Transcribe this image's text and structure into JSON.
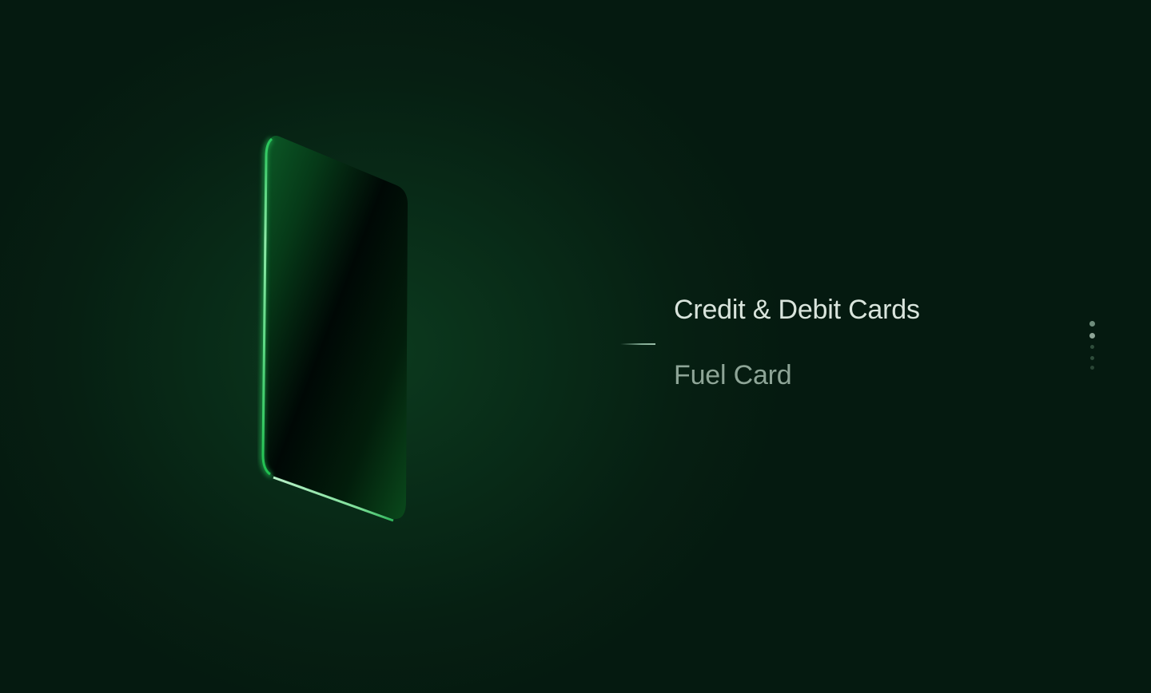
{
  "menu": {
    "items": [
      {
        "label": "Credit & Debit Cards",
        "active": true
      },
      {
        "label": "Fuel Card",
        "active": false
      }
    ]
  },
  "pagination": {
    "total": 5,
    "current": 2
  },
  "colors": {
    "background": "#061f12",
    "accent": "#3fd16a",
    "active_text": "#d9e4dc",
    "inactive_text": "#8ea597"
  }
}
